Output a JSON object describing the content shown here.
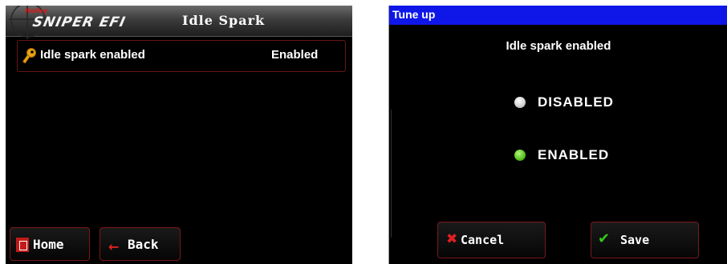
{
  "left_screen": {
    "logo": {
      "brand_small": "Holley",
      "brand_main": "SNIPER EFI"
    },
    "title": "Idle Spark",
    "setting": {
      "icon": "key-icon",
      "label": "Idle spark enabled",
      "value": "Enabled"
    },
    "buttons": {
      "home": "Home",
      "back": "Back"
    }
  },
  "right_screen": {
    "titlebar": "Tune up",
    "heading": "Idle spark enabled",
    "options": [
      {
        "label": "DISABLED",
        "selected": false
      },
      {
        "label": "ENABLED",
        "selected": true
      }
    ],
    "buttons": {
      "cancel": "Cancel",
      "save": "Save"
    }
  },
  "colors": {
    "titlebar_blue": "#0f17e8",
    "button_border_red": "#7a1818",
    "selected_green": "#54c21e",
    "icon_red": "#e02020"
  }
}
